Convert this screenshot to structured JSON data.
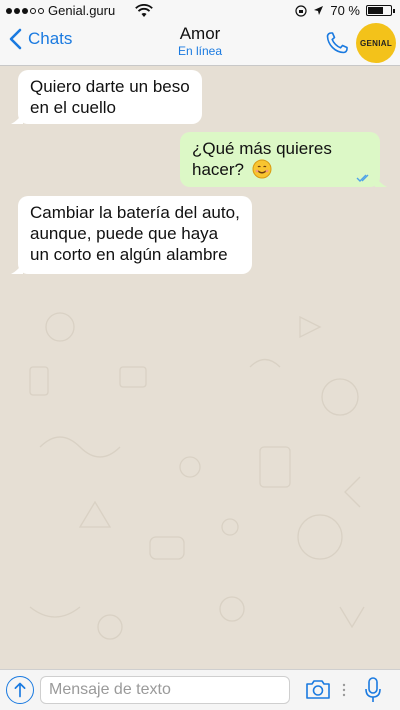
{
  "status_bar": {
    "carrier": "Genial.guru",
    "battery_percent": "70 %",
    "battery_level": 0.7,
    "signal_dots_filled": 3,
    "signal_dots_total": 5
  },
  "header": {
    "back_label": "Chats",
    "title": "Amor",
    "subtitle": "En línea",
    "avatar_text": "GENIAL",
    "accent_color": "#1a7ae0",
    "avatar_color": "#f3c21a"
  },
  "messages": [
    {
      "direction": "in",
      "lines": [
        "Quiero darte un beso",
        "en el cuello"
      ]
    },
    {
      "direction": "out",
      "lines": [
        "¿Qué más quieres",
        "hacer?"
      ],
      "emoji": "smiling-face-emoji",
      "status": "read-ticks"
    },
    {
      "direction": "in",
      "lines": [
        "Cambiar la batería del auto,",
        "aunque, puede que haya",
        "un corto en algún alambre"
      ]
    }
  ],
  "input_bar": {
    "placeholder": "Mensaje de texto",
    "value": ""
  },
  "colors": {
    "outgoing_bubble": "#dcf8c6",
    "incoming_bubble": "#ffffff",
    "chat_background": "#e6dfd4"
  }
}
